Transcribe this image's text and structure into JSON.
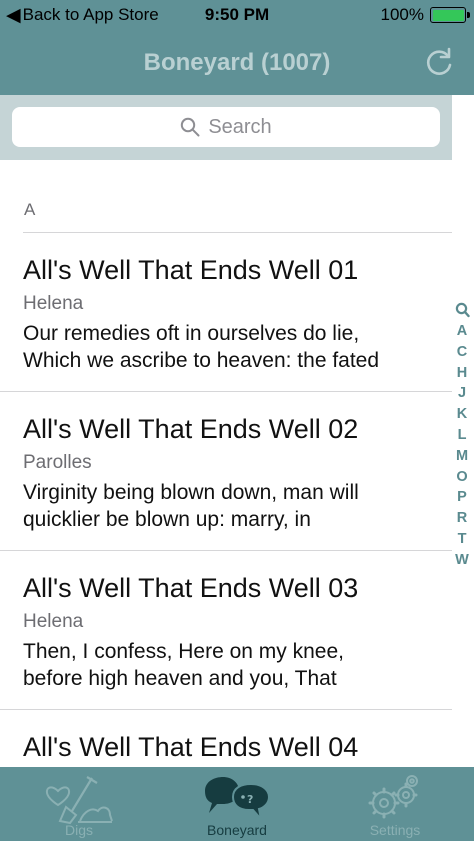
{
  "status_bar": {
    "back_label": "Back to App Store",
    "time": "9:50 PM",
    "battery_text": "100%",
    "battery_level": 1.0
  },
  "nav": {
    "title": "Boneyard (1007)"
  },
  "search": {
    "placeholder": "Search"
  },
  "list": {
    "section": "A",
    "rows": [
      {
        "title": "All's Well That Ends Well 01",
        "character": "Helena",
        "quote_line1": "Our remedies oft in ourselves do lie,",
        "quote_line2": "Which we ascribe to heaven: the fated"
      },
      {
        "title": "All's Well That Ends Well 02",
        "character": "Parolles",
        "quote_line1": "Virginity being blown down, man will",
        "quote_line2": "quicklier be blown up: marry, in"
      },
      {
        "title": "All's Well That Ends Well 03",
        "character": "Helena",
        "quote_line1": "Then, I confess, Here on my knee,",
        "quote_line2": "before high heaven and you, That"
      },
      {
        "title": "All's Well That Ends Well 04"
      }
    ]
  },
  "index_letters": [
    "A",
    "C",
    "H",
    "J",
    "K",
    "L",
    "M",
    "O",
    "P",
    "R",
    "T",
    "W"
  ],
  "tabs": [
    {
      "label": "Digs"
    },
    {
      "label": "Boneyard"
    },
    {
      "label": "Settings"
    }
  ],
  "colors": {
    "accent": "#5f9196",
    "search_background": "#c5d4d6",
    "active_tab": "#163c40",
    "inactive_tab": "#8ab0b3"
  }
}
